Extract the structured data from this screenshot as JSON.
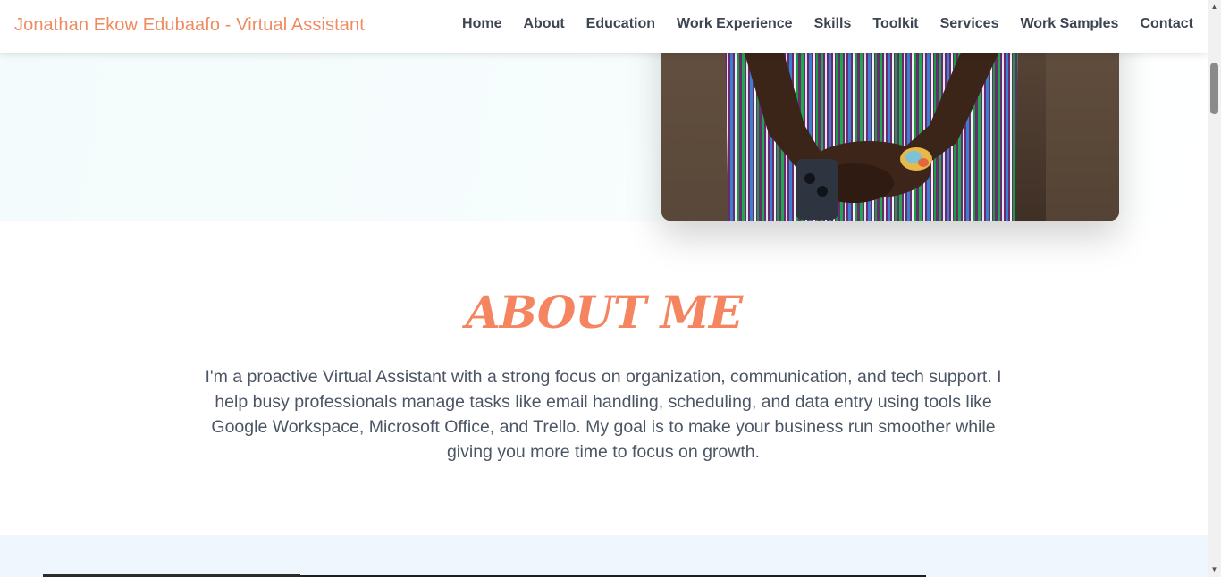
{
  "header": {
    "brand": "Jonathan Ekow Edubaafo - Virtual Assistant",
    "nav": [
      "Home",
      "About",
      "Education",
      "Work Experience",
      "Skills",
      "Toolkit",
      "Services",
      "Work Samples",
      "Contact"
    ]
  },
  "about": {
    "title": "ABOUT ME",
    "text": "I'm a proactive Virtual Assistant with a strong focus on organization, communication, and tech support. I help busy professionals manage tasks like email handling, scheduling, and data entry using tools like Google Workspace, Microsoft Office, and Trello. My goal is to make your business run smoother while giving you more time to focus on growth."
  },
  "colors": {
    "accent": "#f58460",
    "nav_text": "#3d4552",
    "body_text": "#4b5563",
    "next_section_bg": "#eff6fd"
  }
}
